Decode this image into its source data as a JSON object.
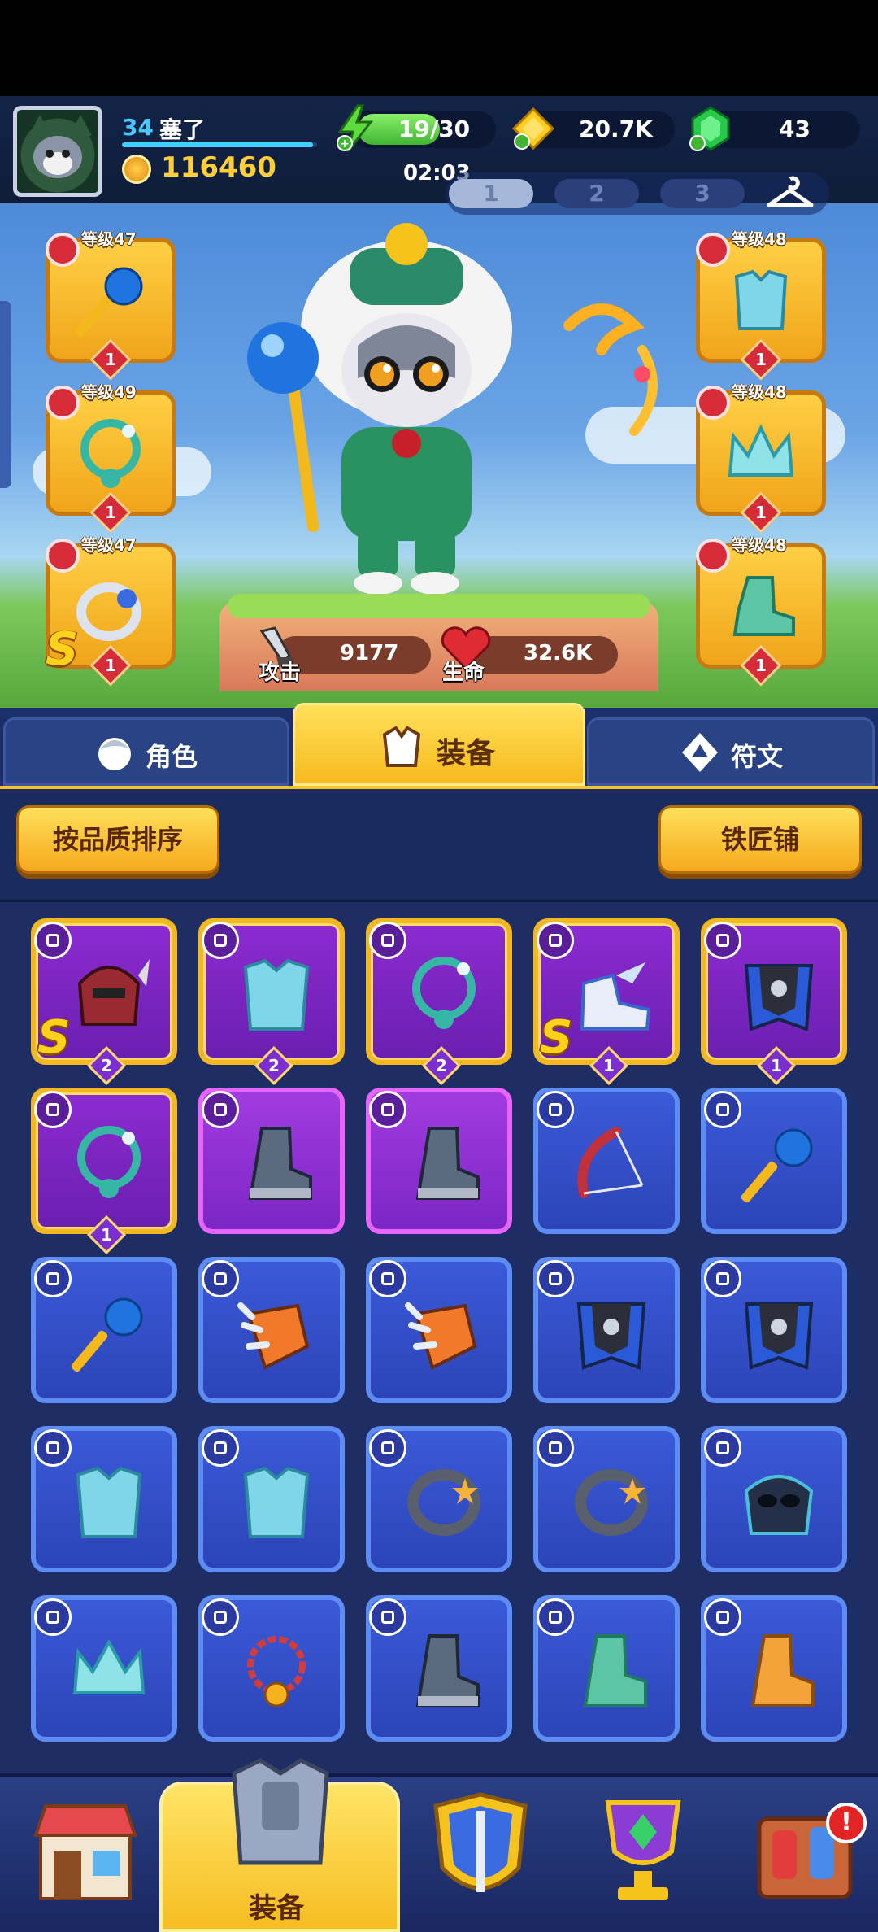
{
  "player": {
    "level": "34",
    "name": "塞了",
    "xp_progress": 0.98,
    "power": "116460"
  },
  "resources": {
    "energy": "19/30",
    "energy_progress": 0.63,
    "timer": "02:03",
    "gold": "20.7K",
    "gems": "43"
  },
  "loadout_tabs": [
    "1",
    "2",
    "3"
  ],
  "loadout_active": "1",
  "equipped": {
    "left": [
      {
        "level_label": "等级47",
        "type": "weapon-icon",
        "item": "blue-orb-staff",
        "count": "1",
        "s_rank": false
      },
      {
        "level_label": "等级49",
        "type": "necklace-icon",
        "item": "teal-vine-necklace",
        "count": "1",
        "s_rank": false
      },
      {
        "level_label": "等级47",
        "type": "ring-icon",
        "item": "winged-silver-ring",
        "count": "1",
        "s_rank": true
      }
    ],
    "right": [
      {
        "level_label": "等级48",
        "type": "armor-icon",
        "item": "teal-chest-armor",
        "count": "1"
      },
      {
        "level_label": "等级48",
        "type": "helmet-icon",
        "item": "teal-crown",
        "count": "1"
      },
      {
        "level_label": "等级48",
        "type": "boots-icon",
        "item": "teal-boots",
        "count": "1"
      }
    ]
  },
  "stats": {
    "attack_label": "攻击",
    "attack_value": "9177",
    "hp_label": "生命",
    "hp_value": "32.6K"
  },
  "main_tabs": {
    "character": "角色",
    "equipment": "装备",
    "rune": "符文",
    "active": "equipment"
  },
  "actions": {
    "sort_label": "按品质排序",
    "blacksmith_label": "铁匠铺"
  },
  "inventory": [
    {
      "frame": "gold",
      "type": "helmet-icon",
      "item": "red-knight-helmet",
      "badge": "2",
      "s_rank": true
    },
    {
      "frame": "gold",
      "type": "armor-icon",
      "item": "teal-chest-armor",
      "badge": "2",
      "s_rank": false
    },
    {
      "frame": "gold",
      "type": "necklace-icon",
      "item": "teal-vine-necklace",
      "badge": "2",
      "s_rank": false
    },
    {
      "frame": "gold",
      "type": "boots-icon",
      "item": "winged-sneakers",
      "badge": "1",
      "s_rank": true
    },
    {
      "frame": "gold",
      "type": "armor-icon",
      "item": "dark-cape-armor",
      "badge": "1",
      "s_rank": false
    },
    {
      "frame": "gold",
      "type": "necklace-icon",
      "item": "teal-vine-necklace",
      "badge": "1",
      "s_rank": false
    },
    {
      "frame": "purple",
      "type": "boots-icon",
      "item": "steel-boots",
      "badge": "",
      "s_rank": false
    },
    {
      "frame": "purple",
      "type": "boots-icon",
      "item": "steel-boots",
      "badge": "",
      "s_rank": false
    },
    {
      "frame": "blue",
      "type": "weapon-icon",
      "item": "red-bow",
      "badge": "",
      "s_rank": false
    },
    {
      "frame": "blue",
      "type": "weapon-icon",
      "item": "blue-orb-staff",
      "badge": "",
      "s_rank": false
    },
    {
      "frame": "blue",
      "type": "weapon-icon",
      "item": "blue-orb-staff",
      "badge": "",
      "s_rank": false
    },
    {
      "frame": "blue",
      "type": "weapon-icon",
      "item": "orange-claw",
      "badge": "",
      "s_rank": false
    },
    {
      "frame": "blue",
      "type": "weapon-icon",
      "item": "orange-claw",
      "badge": "",
      "s_rank": false
    },
    {
      "frame": "blue",
      "type": "armor-icon",
      "item": "dark-cape-armor",
      "badge": "",
      "s_rank": false
    },
    {
      "frame": "blue",
      "type": "armor-icon",
      "item": "dark-cape-armor",
      "badge": "",
      "s_rank": false
    },
    {
      "frame": "blue",
      "type": "armor-icon",
      "item": "teal-chest-armor",
      "badge": "",
      "s_rank": false
    },
    {
      "frame": "blue",
      "type": "armor-icon",
      "item": "teal-chest-armor",
      "badge": "",
      "s_rank": false
    },
    {
      "frame": "blue",
      "type": "ring-icon",
      "item": "star-ring",
      "badge": "",
      "s_rank": false
    },
    {
      "frame": "blue",
      "type": "ring-icon",
      "item": "star-ring",
      "badge": "",
      "s_rank": false
    },
    {
      "frame": "blue",
      "type": "helmet-icon",
      "item": "dark-mask-helmet",
      "badge": "",
      "s_rank": false
    },
    {
      "frame": "blue",
      "type": "helmet-icon",
      "item": "teal-crown",
      "badge": "",
      "s_rank": false
    },
    {
      "frame": "blue",
      "type": "necklace-icon",
      "item": "red-chain-necklace",
      "badge": "",
      "s_rank": false
    },
    {
      "frame": "blue",
      "type": "boots-icon",
      "item": "steel-boots",
      "badge": "",
      "s_rank": false
    },
    {
      "frame": "blue",
      "type": "boots-icon",
      "item": "teal-boots",
      "badge": "",
      "s_rank": false
    },
    {
      "frame": "blue",
      "type": "boots-icon",
      "item": "orange-boots",
      "badge": "",
      "s_rank": false
    }
  ],
  "bottom_nav": {
    "items": [
      "shop-icon",
      "equipment-icon",
      "shield-sword-icon",
      "trophy-icon",
      "event-toys-icon"
    ],
    "active_label": "装备",
    "notification": "!"
  }
}
